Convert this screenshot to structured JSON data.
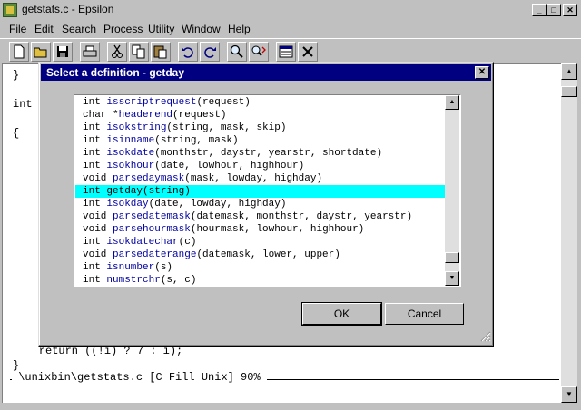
{
  "window": {
    "title": "getstats.c - Epsilon"
  },
  "menu": [
    "File",
    "Edit",
    "Search",
    "Process",
    "Utility",
    "Window",
    "Help"
  ],
  "toolbar": [
    "new-file-icon",
    "open-folder-icon",
    "save-icon",
    "print-icon",
    "cut-icon",
    "copy-icon",
    "paste-icon",
    "undo-icon",
    "redo-icon",
    "search-icon",
    "replace-icon",
    "buffer-list-icon",
    "close-icon"
  ],
  "editor": {
    "lines_top": [
      "}",
      "int",
      "{"
    ],
    "line_return": "    return ((!i) ? 7 : i);",
    "line_brace": "}",
    "modeline": " \\unixbin\\getstats.c [C Fill Unix] 90% "
  },
  "dialog": {
    "title": "Select a definition - getday",
    "close_label": "✕",
    "items": [
      {
        "pre": "int ",
        "fn": "isscriptrequest",
        "args": "(request)"
      },
      {
        "pre": "char *",
        "fn": "headerend",
        "args": "(request)"
      },
      {
        "pre": "int ",
        "fn": "isokstring",
        "args": "(string, mask, skip)"
      },
      {
        "pre": "int ",
        "fn": "isinname",
        "args": "(string, mask)"
      },
      {
        "pre": "int ",
        "fn": "isokdate",
        "args": "(monthstr, daystr, yearstr, shortdate)"
      },
      {
        "pre": "int ",
        "fn": "isokhour",
        "args": "(date, lowhour, highhour)"
      },
      {
        "pre": "void ",
        "fn": "parsedaymask",
        "args": "(mask, lowday, highday)"
      },
      {
        "pre": "int ",
        "fn": "getday",
        "args": "(string)"
      },
      {
        "pre": "int ",
        "fn": "isokday",
        "args": "(date, lowday, highday)"
      },
      {
        "pre": "void ",
        "fn": "parsedatemask",
        "args": "(datemask, monthstr, daystr, yearstr)"
      },
      {
        "pre": "void ",
        "fn": "parsehourmask",
        "args": "(hourmask, lowhour, highhour)"
      },
      {
        "pre": "int ",
        "fn": "isokdatechar",
        "args": "(c)"
      },
      {
        "pre": "void ",
        "fn": "parsedaterange",
        "args": "(datemask, lower, upper)"
      },
      {
        "pre": "int ",
        "fn": "isnumber",
        "args": "(s)"
      },
      {
        "pre": "int ",
        "fn": "numstrchr",
        "args": "(s, c)"
      }
    ],
    "selected_index": 7,
    "ok_label": "OK",
    "cancel_label": "Cancel"
  }
}
